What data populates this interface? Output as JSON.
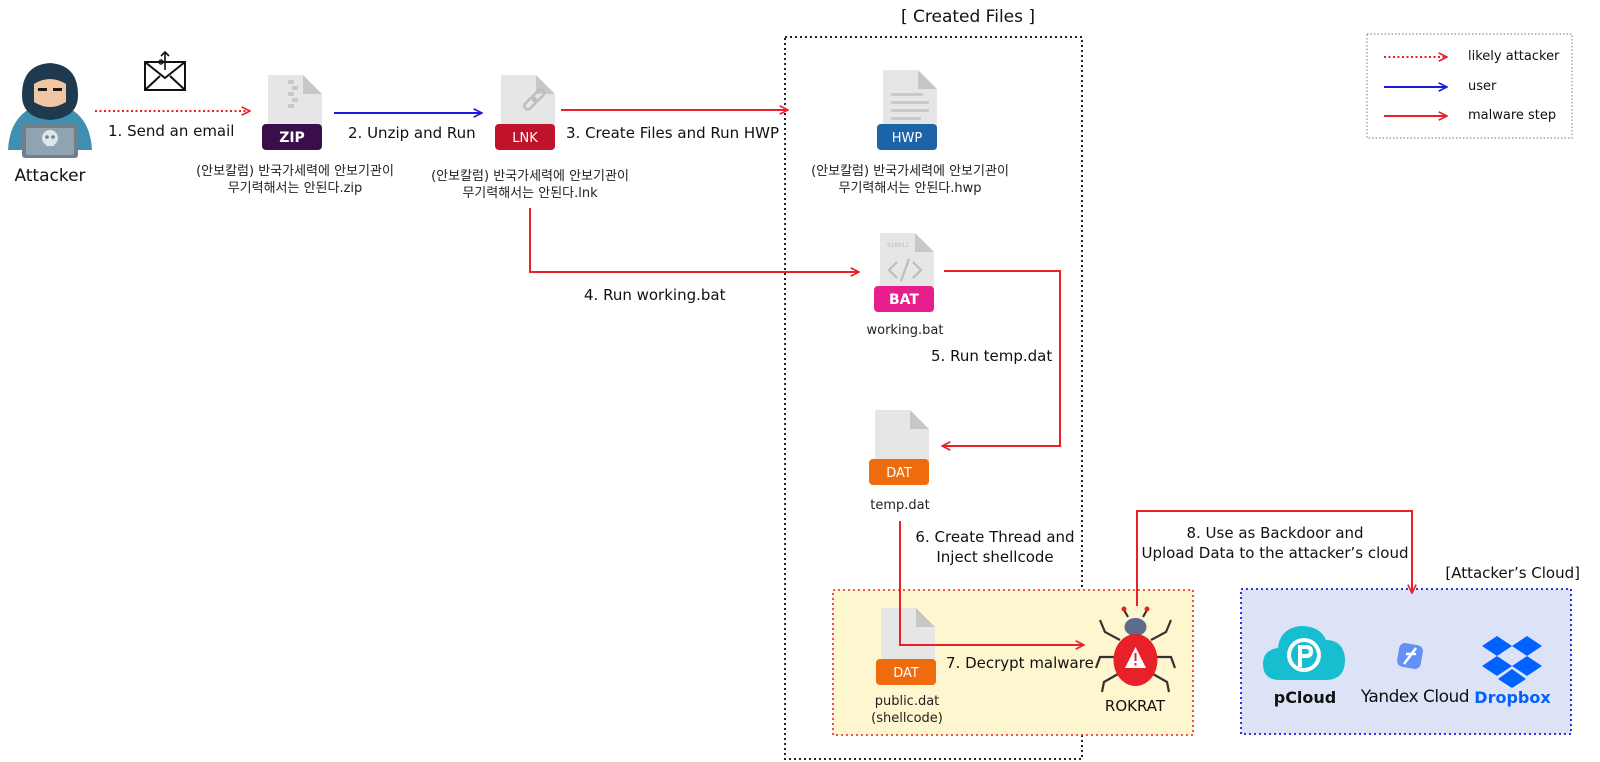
{
  "section_title": "[ Created Files ]",
  "attacker_cloud_title": "[Attacker’s Cloud]",
  "attacker": {
    "label": "Attacker"
  },
  "legend": {
    "items": [
      {
        "label": "likely attacker",
        "style": "dotted",
        "color": "#e8202a"
      },
      {
        "label": "user",
        "style": "solid",
        "color": "#1a1adb"
      },
      {
        "label": "malware step",
        "style": "solid",
        "color": "#e8202a"
      }
    ]
  },
  "files": {
    "zip": {
      "tag": "ZIP",
      "tag_color": "#3a0e4a",
      "name_line1": "(안보칼럼) 반국가세력에 안보기관이",
      "name_line2": "무기력해서는 안된다.zip"
    },
    "lnk": {
      "tag": "LNK",
      "tag_color": "#c0122b",
      "name_line1": "(안보칼럼) 반국가세력에 안보기관이",
      "name_line2": "무기력해서는 안된다.lnk"
    },
    "hwp": {
      "tag": "HWP",
      "tag_color": "#1d63a8",
      "name_line1": "(안보칼럼) 반국가세력에 안보기관이",
      "name_line2": "무기력해서는 안된다.hwp"
    },
    "bat": {
      "tag": "BAT",
      "tag_color": "#e81e8c",
      "name": "working.bat"
    },
    "dat": {
      "tag": "DAT",
      "tag_color": "#ef6c0e",
      "name": "temp.dat"
    },
    "public_dat": {
      "tag": "DAT",
      "tag_color": "#ef6c0e",
      "name_line1": "public.dat",
      "name_line2": "(shellcode)"
    }
  },
  "steps": {
    "s1": "1. Send an email",
    "s2": "2. Unzip and Run",
    "s3": "3. Create Files and Run HWP",
    "s4": "4. Run working.bat",
    "s5": "5. Run temp.dat",
    "s6_line1": "6. Create Thread and",
    "s6_line2": "Inject shellcode",
    "s7": "7. Decrypt malware",
    "s8_line1": "8. Use as Backdoor and",
    "s8_line2": "Upload Data to the attacker’s cloud"
  },
  "rokrat": {
    "label": "ROKRAT"
  },
  "clouds": {
    "pcloud": {
      "name": "pCloud",
      "color": "#17bed0"
    },
    "yandex": {
      "name": "Yandex Cloud",
      "color": "#4d82f5"
    },
    "dropbox": {
      "name": "Dropbox",
      "color": "#0061ff"
    }
  },
  "colors": {
    "red": "#e8202a",
    "blue": "#1a1adb",
    "malware_box_fill": "#fdf6cf",
    "cloud_box_fill": "#dde3f6"
  }
}
